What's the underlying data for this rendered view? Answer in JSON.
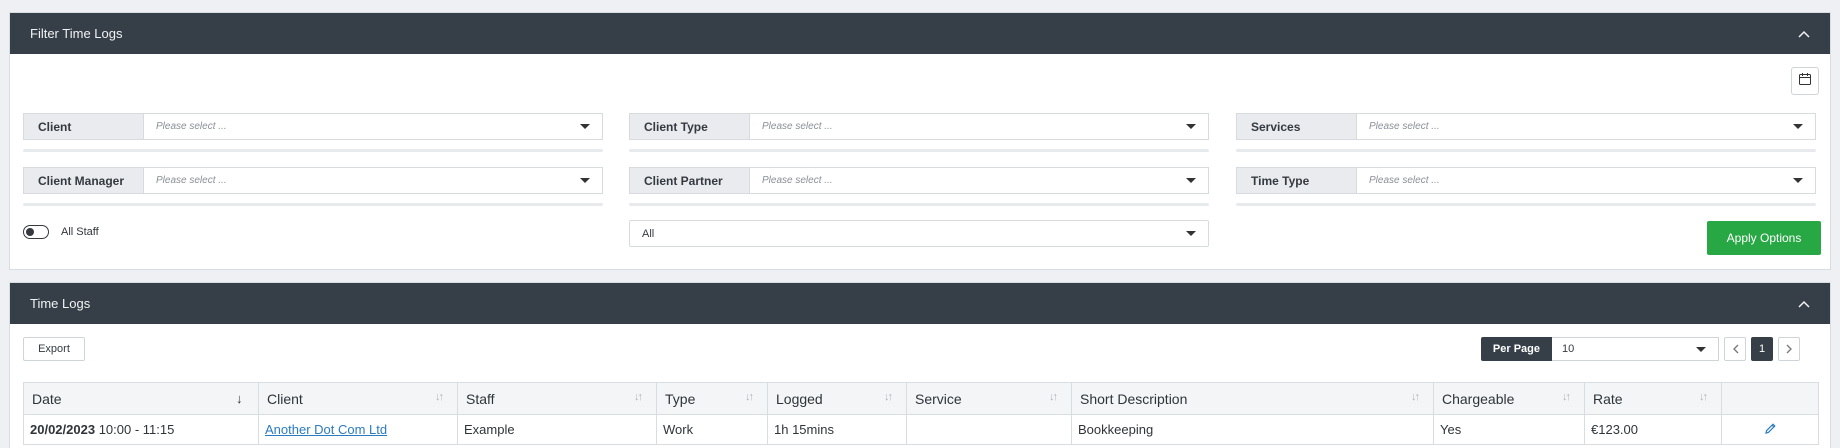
{
  "filter_panel": {
    "title": "Filter Time Logs",
    "fields": [
      {
        "label": "Client",
        "placeholder": "Please select ..."
      },
      {
        "label": "Client Type",
        "placeholder": "Please select ..."
      },
      {
        "label": "Services",
        "placeholder": "Please select ..."
      },
      {
        "label": "Client Manager",
        "placeholder": "Please select ..."
      },
      {
        "label": "Client Partner",
        "placeholder": "Please select ..."
      },
      {
        "label": "Time Type",
        "placeholder": "Please select ..."
      }
    ],
    "all_staff_label": "All Staff",
    "all_select_value": "All",
    "apply_label": "Apply Options"
  },
  "logs_panel": {
    "title": "Time Logs",
    "export_label": "Export",
    "per_page_label": "Per Page",
    "per_page_value": "10",
    "current_page": "1",
    "columns": [
      "Date",
      "Client",
      "Staff",
      "Type",
      "Logged",
      "Service",
      "Short Description",
      "Chargeable",
      "Rate"
    ],
    "rows": [
      {
        "date": "20/02/2023",
        "time": "10:00 - 11:15",
        "client": "Another Dot Com Ltd",
        "staff": "Example",
        "type": "Work",
        "logged": "1h 15mins",
        "service": "",
        "description": "Bookkeeping",
        "chargeable": "Yes",
        "rate": "€123.00"
      }
    ]
  },
  "colors": {
    "header_bg": "#363f48",
    "apply_green": "#28a745",
    "link_blue": "#2b7bc0"
  }
}
